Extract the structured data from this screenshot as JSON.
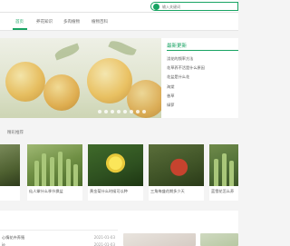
{
  "search": {
    "placeholder": "输入关键词"
  },
  "nav": {
    "items": [
      "首页",
      "养花知识",
      "多肉植物",
      "植物百科"
    ]
  },
  "news": {
    "title": "最新更新",
    "items": [
      "浇花的频率方法",
      "花草养不活是什么原因",
      "花盆是什么花",
      "海棠",
      "香草",
      "绿萝"
    ]
  },
  "recommend": {
    "title": "精彩推荐",
    "cards": [
      {
        "caption": ""
      },
      {
        "caption": "仙人掌什么季节换盆"
      },
      {
        "caption": "黄金菊什么时候可以种"
      },
      {
        "caption": "三角梅盛花期多少天"
      },
      {
        "caption": "蓝雪花怎么养"
      }
    ]
  },
  "bottom": {
    "items": [
      {
        "text": "心情花卉养殖",
        "date": "2021-01-03"
      },
      {
        "text": "ie",
        "date": "2021-01-03"
      }
    ]
  }
}
